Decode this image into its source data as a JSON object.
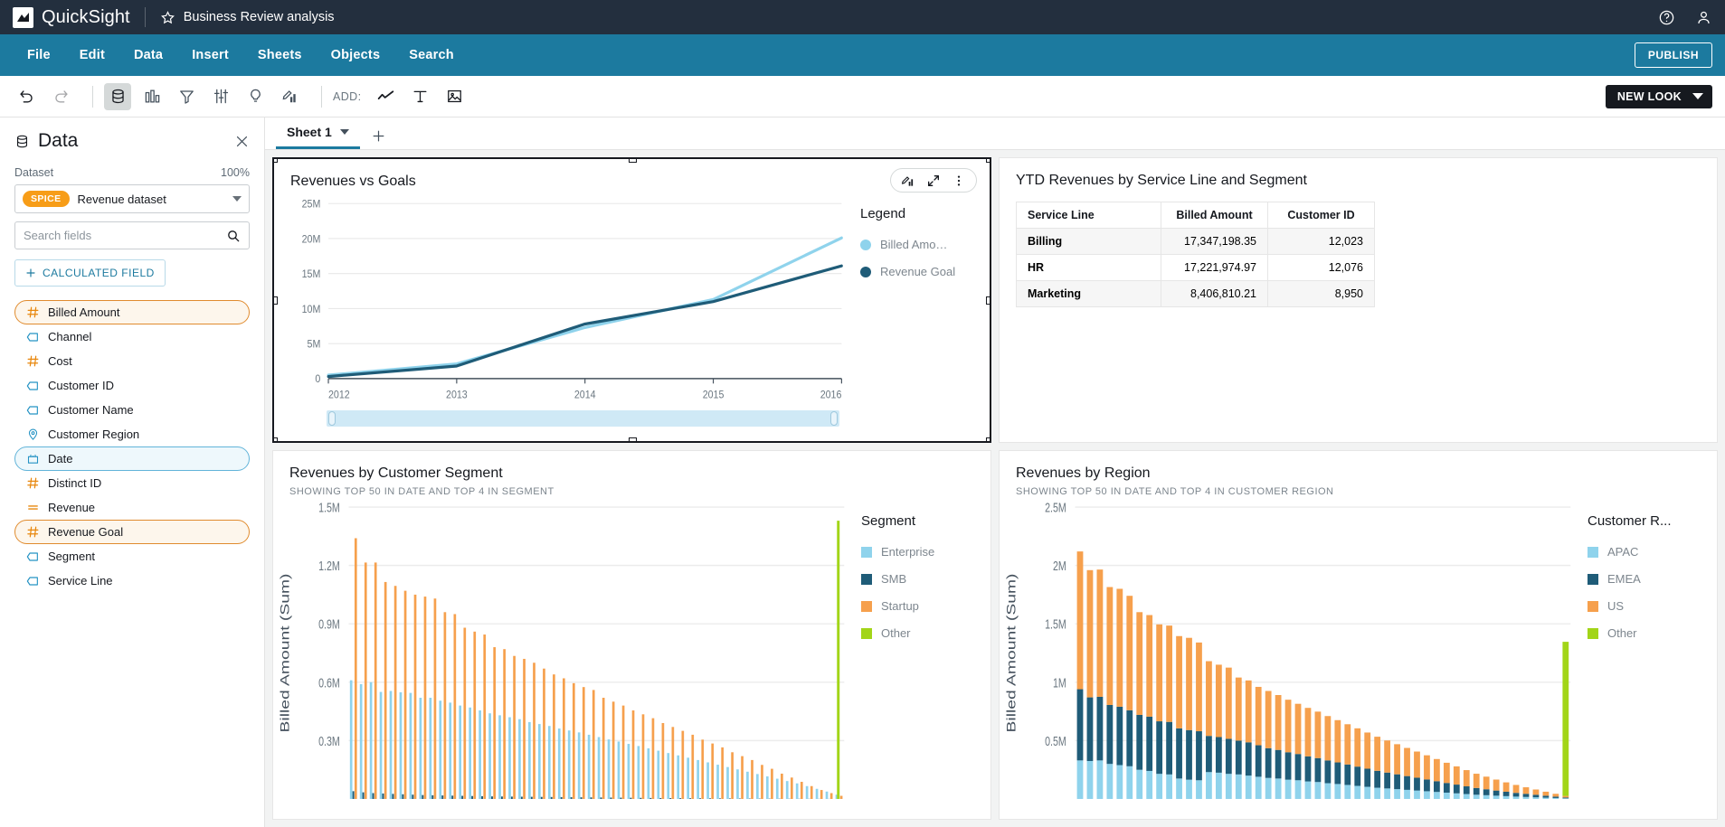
{
  "app": {
    "brand": "QuickSight",
    "document_title": "Business Review analysis",
    "logo_icon": "quicksight-logo-icon",
    "favorite_icon": "star-icon",
    "help_icon": "help-circle-icon",
    "account_icon": "user-icon"
  },
  "menubar": {
    "items": [
      {
        "label": "File"
      },
      {
        "label": "Edit"
      },
      {
        "label": "Data"
      },
      {
        "label": "Insert"
      },
      {
        "label": "Sheets"
      },
      {
        "label": "Objects"
      },
      {
        "label": "Search"
      }
    ],
    "publish_label": "PUBLISH"
  },
  "toolbar": {
    "undo_icon": "undo-icon",
    "redo_icon": "redo-icon",
    "data_icon": "database-icon",
    "visuals_icon": "bar-chart-icon",
    "filter_icon": "filter-funnel-icon",
    "parameters_icon": "sliders-icon",
    "insights_icon": "lightbulb-icon",
    "themes_icon": "paint-chart-icon",
    "add_label": "ADD:",
    "add_visual_icon": "line-chart-icon",
    "add_text_icon": "text-icon",
    "add_image_icon": "image-icon",
    "new_look_label": "NEW LOOK",
    "new_look_caret_icon": "chevron-down-icon"
  },
  "data_panel": {
    "icon": "database-icon",
    "title": "Data",
    "close_icon": "close-icon",
    "dataset_label": "Dataset",
    "dataset_percent": "100%",
    "spice_badge": "SPICE",
    "dataset_name": "Revenue dataset",
    "dataset_caret_icon": "chevron-down-icon",
    "search_placeholder": "Search fields",
    "search_value": "",
    "search_icon": "search-icon",
    "calculated_field_label": "CALCULATED FIELD",
    "calculated_field_plus_icon": "plus-icon",
    "fields": [
      {
        "label": "Billed Amount",
        "type": "number",
        "icon": "hash-icon",
        "state": "selected-orange"
      },
      {
        "label": "Channel",
        "type": "string",
        "icon": "tag-icon",
        "state": "none"
      },
      {
        "label": "Cost",
        "type": "number",
        "icon": "hash-icon",
        "state": "none"
      },
      {
        "label": "Customer ID",
        "type": "string",
        "icon": "tag-icon",
        "state": "none"
      },
      {
        "label": "Customer Name",
        "type": "string",
        "icon": "tag-icon",
        "state": "none"
      },
      {
        "label": "Customer Region",
        "type": "geo",
        "icon": "location-pin-icon",
        "state": "none"
      },
      {
        "label": "Date",
        "type": "date",
        "icon": "calendar-icon",
        "state": "selected-blue"
      },
      {
        "label": "Distinct ID",
        "type": "number",
        "icon": "hash-icon",
        "state": "none"
      },
      {
        "label": "Revenue",
        "type": "measure",
        "icon": "equals-icon",
        "state": "none"
      },
      {
        "label": "Revenue Goal",
        "type": "number",
        "icon": "hash-icon",
        "state": "selected-orange"
      },
      {
        "label": "Segment",
        "type": "string",
        "icon": "tag-icon",
        "state": "none"
      },
      {
        "label": "Service Line",
        "type": "string",
        "icon": "tag-icon",
        "state": "none"
      }
    ]
  },
  "sheets": {
    "active_tab": "Sheet 1",
    "tab_caret_icon": "chevron-down-icon",
    "add_sheet_icon": "plus-icon"
  },
  "colors": {
    "brand_dark": "#232f3e",
    "menu_blue": "#1c7a9f",
    "accent_orange": "#f79d18",
    "series_light_blue": "#8fd3ec",
    "series_dark_blue": "#1f5c78",
    "series_orange": "#f6a04d",
    "series_green": "#a2d518"
  },
  "visuals": {
    "line": {
      "title": "Revenues vs Goals",
      "selected": true,
      "menu_icons": [
        "edit-chart-icon",
        "expand-icon",
        "kebab-menu-icon"
      ],
      "legend_title": "Legend",
      "slider_name": "date-range-slider"
    },
    "pivot": {
      "title": "YTD Revenues by Service Line and Segment",
      "columns": [
        "Service Line",
        "Billed Amount",
        "Customer ID"
      ],
      "rows": [
        {
          "label": "Billing",
          "billed_amount": "17,347,198.35",
          "customer_id": "12,023"
        },
        {
          "label": "HR",
          "billed_amount": "17,221,974.97",
          "customer_id": "12,076"
        },
        {
          "label": "Marketing",
          "billed_amount": "8,406,810.21",
          "customer_id": "8,950"
        }
      ]
    },
    "segment": {
      "title": "Revenues by Customer Segment",
      "subtitle": "SHOWING TOP 50 IN DATE AND TOP 4 IN SEGMENT",
      "legend_title": "Segment"
    },
    "region": {
      "title": "Revenues by Region",
      "subtitle": "SHOWING TOP 50 IN DATE AND TOP 4 IN CUSTOMER REGION",
      "legend_title": "Customer R..."
    }
  },
  "chart_data": [
    {
      "id": "revenues_vs_goals",
      "type": "line",
      "title": "Revenues vs Goals",
      "xlabel": "",
      "ylabel": "",
      "x": [
        2012,
        2013,
        2014,
        2015,
        2016
      ],
      "xticks": [
        "2012",
        "2013",
        "2014",
        "2015",
        "2016"
      ],
      "yticks": [
        "0",
        "5M",
        "10M",
        "15M",
        "20M",
        "25M"
      ],
      "ylim": [
        0,
        25000000
      ],
      "grid": true,
      "legend_position": "right",
      "series": [
        {
          "name": "Billed Amount",
          "color": "#8fd3ec",
          "values": [
            500000,
            2100000,
            7300000,
            11300000,
            20100000
          ]
        },
        {
          "name": "Revenue Goal",
          "color": "#1f5c78",
          "values": [
            300000,
            1800000,
            7800000,
            11000000,
            16100000
          ]
        }
      ]
    },
    {
      "id": "ytd_revenues_by_service_line_and_segment",
      "type": "table",
      "title": "YTD Revenues by Service Line and Segment",
      "columns": [
        "Service Line",
        "Billed Amount",
        "Customer ID"
      ],
      "rows": [
        [
          "Billing",
          "17,347,198.35",
          "12,023"
        ],
        [
          "HR",
          "17,221,974.97",
          "12,076"
        ],
        [
          "Marketing",
          "8,406,810.21",
          "8,950"
        ]
      ]
    },
    {
      "id": "revenues_by_customer_segment",
      "type": "bar",
      "title": "Revenues by Customer Segment",
      "subtitle": "SHOWING TOP 50 IN DATE AND TOP 4 IN SEGMENT",
      "ylabel": "Billed Amount (Sum)",
      "yticks": [
        "0.3M",
        "0.6M",
        "0.9M",
        "1.2M",
        "1.5M"
      ],
      "ylim": [
        0,
        1500000
      ],
      "grid": true,
      "legend_position": "right",
      "grouped": true,
      "categories_count": 50,
      "series": [
        {
          "name": "Enterprise",
          "color": "#8fd3ec",
          "values": [
            610000,
            590000,
            600000,
            550000,
            555000,
            548000,
            545000,
            520000,
            520000,
            505000,
            495000,
            480000,
            470000,
            455000,
            440000,
            430000,
            420000,
            410000,
            395000,
            385000,
            375000,
            362000,
            352000,
            342000,
            330000,
            318000,
            306000,
            295000,
            283000,
            272000,
            260000,
            248000,
            236000,
            224000,
            212000,
            200000,
            188000,
            176000,
            164000,
            152000,
            140000,
            128000,
            116000,
            104000,
            92000,
            80000,
            66000,
            52000,
            38000,
            22000
          ]
        },
        {
          "name": "SMB",
          "color": "#1f5c78",
          "values": [
            40000,
            34000,
            30000,
            28000,
            26000,
            24000,
            22000,
            20000,
            19000,
            18000,
            17000,
            16000,
            15000,
            14000,
            13000,
            12500,
            12000,
            11500,
            11000,
            10500,
            10000,
            9500,
            9000,
            8500,
            8000,
            7500,
            7000,
            6500,
            6000,
            5500,
            5000,
            4700,
            4400,
            4100,
            3800,
            3500,
            3200,
            2900,
            2600,
            2300,
            2000,
            1800,
            1600,
            1400,
            1200,
            1000,
            800,
            600,
            400,
            200
          ]
        },
        {
          "name": "Startup",
          "color": "#f6a04d",
          "values": [
            1340000,
            1215000,
            1215000,
            1115000,
            1095000,
            1070000,
            1050000,
            1040000,
            1030000,
            960000,
            950000,
            880000,
            860000,
            845000,
            780000,
            770000,
            735000,
            720000,
            700000,
            670000,
            640000,
            620000,
            595000,
            575000,
            560000,
            520000,
            500000,
            480000,
            455000,
            435000,
            415000,
            390000,
            370000,
            350000,
            330000,
            305000,
            285000,
            265000,
            240000,
            220000,
            200000,
            175000,
            155000,
            130000,
            110000,
            88000,
            66000,
            46000,
            30000,
            16000
          ]
        },
        {
          "name": "Other",
          "color": "#a2d518",
          "values": [
            0,
            0,
            0,
            0,
            0,
            0,
            0,
            0,
            0,
            0,
            0,
            0,
            0,
            0,
            0,
            0,
            0,
            0,
            0,
            0,
            0,
            0,
            0,
            0,
            0,
            0,
            0,
            0,
            0,
            0,
            0,
            0,
            0,
            0,
            0,
            0,
            0,
            0,
            0,
            0,
            0,
            0,
            0,
            0,
            0,
            0,
            0,
            0,
            0,
            1430000
          ]
        }
      ]
    },
    {
      "id": "revenues_by_region",
      "type": "bar",
      "title": "Revenues by Region",
      "subtitle": "SHOWING TOP 50 IN DATE AND TOP 4 IN CUSTOMER REGION",
      "ylabel": "Billed Amount (Sum)",
      "yticks": [
        "0.5M",
        "1M",
        "1.5M",
        "2M",
        "2.5M"
      ],
      "ylim": [
        0,
        2500000
      ],
      "grid": true,
      "legend_position": "right",
      "stacked": true,
      "categories_count": 50,
      "series": [
        {
          "name": "APAC",
          "color": "#8fd3ec",
          "values": [
            330000,
            325000,
            330000,
            300000,
            290000,
            280000,
            250000,
            240000,
            215000,
            210000,
            175000,
            165000,
            160000,
            230000,
            225000,
            215000,
            210000,
            200000,
            190000,
            180000,
            175000,
            165000,
            160000,
            150000,
            145000,
            135000,
            128000,
            120000,
            112000,
            104000,
            96000,
            90000,
            84000,
            78000,
            72000,
            66000,
            60000,
            54000,
            48000,
            42000,
            36000,
            32000,
            28000,
            24000,
            20000,
            17000,
            14000,
            11000,
            8000,
            5000
          ]
        },
        {
          "name": "EMEA",
          "color": "#1f5c78",
          "values": [
            610000,
            545000,
            545000,
            505000,
            500000,
            480000,
            470000,
            465000,
            450000,
            450000,
            430000,
            425000,
            420000,
            310000,
            305000,
            300000,
            290000,
            285000,
            270000,
            255000,
            245000,
            235000,
            225000,
            215000,
            205000,
            195000,
            185000,
            175000,
            165000,
            155000,
            145000,
            136000,
            127000,
            118000,
            110000,
            101000,
            92000,
            83000,
            75000,
            66000,
            58000,
            51000,
            44000,
            38000,
            32000,
            27000,
            22000,
            17000,
            12000,
            7000
          ]
        },
        {
          "name": "US",
          "color": "#f6a04d",
          "values": [
            1180000,
            1090000,
            1090000,
            1010000,
            1010000,
            980000,
            880000,
            870000,
            830000,
            825000,
            790000,
            790000,
            760000,
            640000,
            620000,
            610000,
            540000,
            530000,
            500000,
            490000,
            470000,
            450000,
            430000,
            415000,
            398000,
            380000,
            362000,
            345000,
            328000,
            310000,
            292000,
            275000,
            258000,
            241000,
            224000,
            207000,
            190000,
            173000,
            156000,
            139000,
            122000,
            108000,
            94000,
            80000,
            68000,
            56000,
            45000,
            34000,
            24000,
            14000
          ]
        },
        {
          "name": "Other",
          "color": "#a2d518",
          "values": [
            0,
            0,
            0,
            0,
            0,
            0,
            0,
            0,
            0,
            0,
            0,
            0,
            0,
            0,
            0,
            0,
            0,
            0,
            0,
            0,
            0,
            0,
            0,
            0,
            0,
            0,
            0,
            0,
            0,
            0,
            0,
            0,
            0,
            0,
            0,
            0,
            0,
            0,
            0,
            0,
            0,
            0,
            0,
            0,
            0,
            0,
            0,
            0,
            0,
            1320000
          ]
        }
      ]
    }
  ]
}
